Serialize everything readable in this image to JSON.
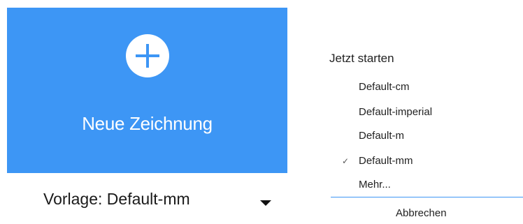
{
  "new_drawing": {
    "label": "Neue Zeichnung",
    "icon": "plus-icon",
    "color": "#3d96f5"
  },
  "template": {
    "label": "Vorlage: Default-mm",
    "icon": "dropdown-arrow-icon"
  },
  "menu": {
    "heading": "Jetzt starten",
    "items": [
      {
        "label": "Default-cm",
        "checked": false
      },
      {
        "label": "Default-imperial",
        "checked": false
      },
      {
        "label": "Default-m",
        "checked": false
      },
      {
        "label": "Default-mm",
        "checked": true
      },
      {
        "label": "Mehr...",
        "checked": false
      }
    ],
    "check_mark": "✓",
    "cancel_label": "Abbrechen",
    "divider_color": "#3d96f5"
  }
}
